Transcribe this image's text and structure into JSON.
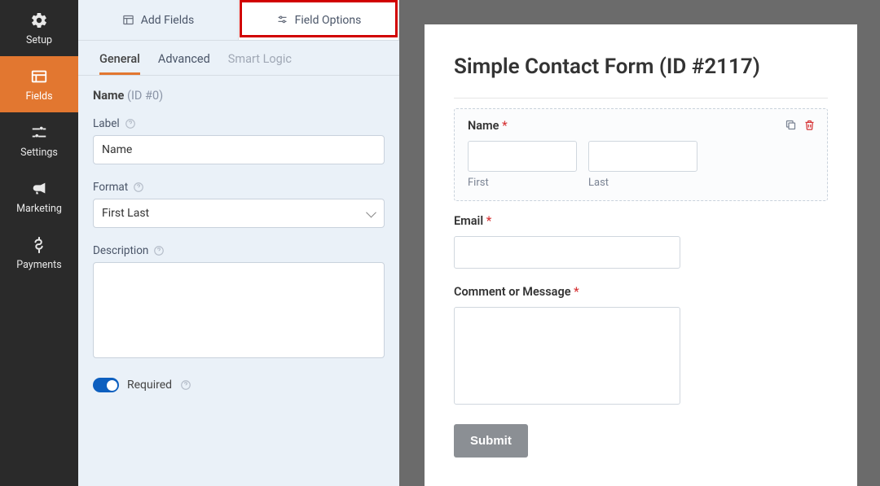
{
  "sidebar": {
    "items": [
      {
        "label": "Setup"
      },
      {
        "label": "Fields"
      },
      {
        "label": "Settings"
      },
      {
        "label": "Marketing"
      },
      {
        "label": "Payments"
      }
    ]
  },
  "panel": {
    "tabs": {
      "add_fields": "Add Fields",
      "field_options": "Field Options"
    },
    "sub_tabs": {
      "general": "General",
      "advanced": "Advanced",
      "smart_logic": "Smart Logic"
    },
    "field_header": {
      "name": "Name",
      "id": "(ID #0)"
    },
    "label_label": "Label",
    "label_value": "Name",
    "format_label": "Format",
    "format_value": "First Last",
    "description_label": "Description",
    "description_value": "",
    "required_label": "Required"
  },
  "preview": {
    "title": "Simple Contact Form (ID #2117)",
    "name_field": {
      "label": "Name",
      "sub1": "First",
      "sub2": "Last"
    },
    "email_field": {
      "label": "Email"
    },
    "message_field": {
      "label": "Comment or Message"
    },
    "submit": "Submit"
  }
}
